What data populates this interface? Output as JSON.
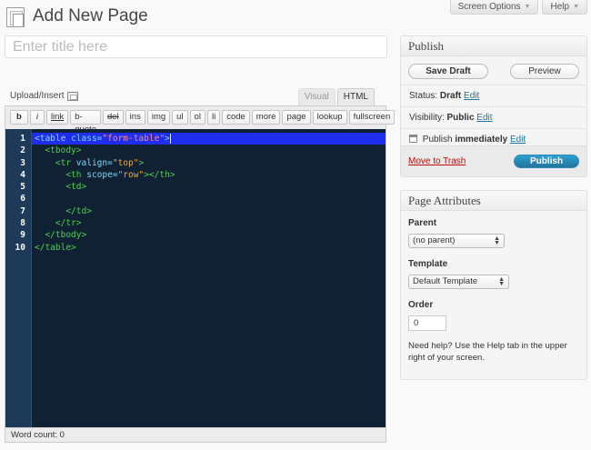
{
  "screen_meta": {
    "options_label": "Screen Options",
    "help_label": "Help"
  },
  "header": {
    "title": "Add New Page"
  },
  "title_input": {
    "placeholder": "Enter title here",
    "value": ""
  },
  "media": {
    "upload_label": "Upload/Insert"
  },
  "editor": {
    "tabs": [
      {
        "label": "Visual"
      },
      {
        "label": "HTML"
      }
    ],
    "active_tab": "HTML",
    "toolbar": [
      "b",
      "i",
      "link",
      "b-quote",
      "del",
      "ins",
      "img",
      "ul",
      "ol",
      "li",
      "code",
      "more",
      "page",
      "lookup",
      "fullscreen"
    ],
    "line_numbers": [
      "1",
      "2",
      "3",
      "4",
      "5",
      "6",
      "7",
      "8",
      "9",
      "10"
    ],
    "code_lines": [
      "<table class=\"form-table\">",
      "  <tbody>",
      "    <tr valign=\"top\">",
      "      <th scope=\"row\"></th>",
      "      <td>",
      "",
      "      </td>",
      "    </tr>",
      "  </tbody>",
      "</table>"
    ],
    "word_count": "Word count: 0"
  },
  "publish": {
    "heading": "Publish",
    "save_draft": "Save Draft",
    "preview": "Preview",
    "status_label": "Status:",
    "status_value": "Draft",
    "visibility_label": "Visibility:",
    "visibility_value": "Public",
    "publish_label": "Publish",
    "publish_value": "immediately",
    "edit": "Edit",
    "trash": "Move to Trash",
    "publish_button": "Publish"
  },
  "page_attributes": {
    "heading": "Page Attributes",
    "parent_label": "Parent",
    "parent_value": "(no parent)",
    "template_label": "Template",
    "template_value": "Default Template",
    "order_label": "Order",
    "order_value": "0",
    "help_text": "Need help? Use the Help tab in the upper right of your screen."
  },
  "colors": {
    "code_bg": "#0f2132",
    "gutter_bg": "#1d3a58",
    "selection": "#1f2eed",
    "tag": "#4fd04f",
    "attr": "#7bd8ff",
    "value": "#f2a63c",
    "link": "#21759b",
    "trash": "#bc0b0b",
    "publish_btn": "#21759b"
  }
}
